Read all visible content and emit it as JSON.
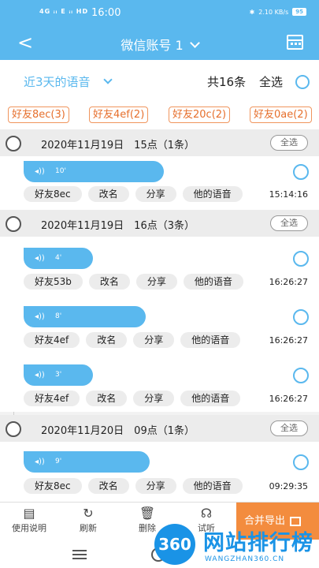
{
  "status": {
    "signal": "4G ᵢₗ E ᵢₗ HD",
    "time": "16:00",
    "net_speed": "2.10 KB/s",
    "battery": "95"
  },
  "nav": {
    "title": "微信账号 1"
  },
  "filter": {
    "range": "近3天的语音",
    "total": "共16条",
    "select_all": "全选"
  },
  "tags": [
    "好友8ec(3)",
    "好友4ef(2)",
    "好友20c(2)",
    "好友0ae(2)"
  ],
  "groups": [
    {
      "date": "2020年11月19日　15点（1条）",
      "select_label": "全选",
      "items": [
        {
          "duration": "10'",
          "sender": "好友8ec",
          "time": "15:14:16"
        }
      ]
    },
    {
      "date": "2020年11月19日　16点（3条）",
      "select_label": "全选",
      "items": [
        {
          "duration": "4'",
          "sender": "好友53b",
          "time": "16:26:27"
        },
        {
          "duration": "8'",
          "sender": "好友4ef",
          "time": "16:26:27"
        },
        {
          "duration": "3'",
          "sender": "好友4ef",
          "time": "16:26:27"
        }
      ]
    },
    {
      "date": "2020年11月20日　09点（1条）",
      "select_label": "全选",
      "items": [
        {
          "duration": "9'",
          "sender": "好友8ec",
          "time": "09:29:35"
        }
      ]
    }
  ],
  "actions": {
    "rename": "改名",
    "share": "分享",
    "their_voice": "他的语音"
  },
  "toolbar": {
    "help": "使用说明",
    "refresh": "刷新",
    "delete": "删除",
    "listen": "试听",
    "merge_export": "合并导出"
  },
  "watermark": {
    "logo": "360",
    "name": "网站排行榜",
    "url": "WANGZHAN360.CN"
  }
}
